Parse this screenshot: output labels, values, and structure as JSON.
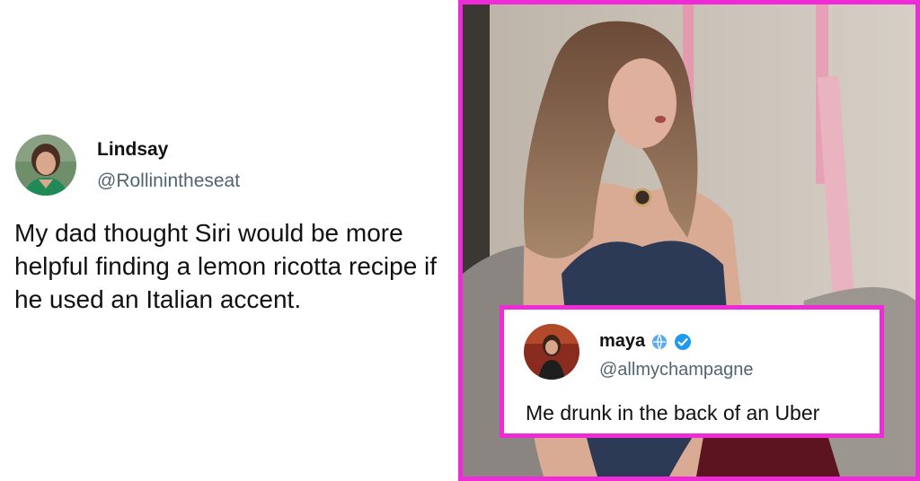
{
  "left_tweet": {
    "name": "Lindsay",
    "handle": "@Rollinintheseat",
    "text": "My dad thought Siri would be more helpful finding a lemon ricotta recipe if he used an Italian accent."
  },
  "photo": {
    "frame_color": "#ee2bd6"
  },
  "inset_tweet": {
    "name": "maya",
    "handle": "@allmychampagne",
    "text": "Me drunk in the back of an Uber",
    "badges": [
      "globe-icon",
      "verified-badge-icon"
    ]
  }
}
